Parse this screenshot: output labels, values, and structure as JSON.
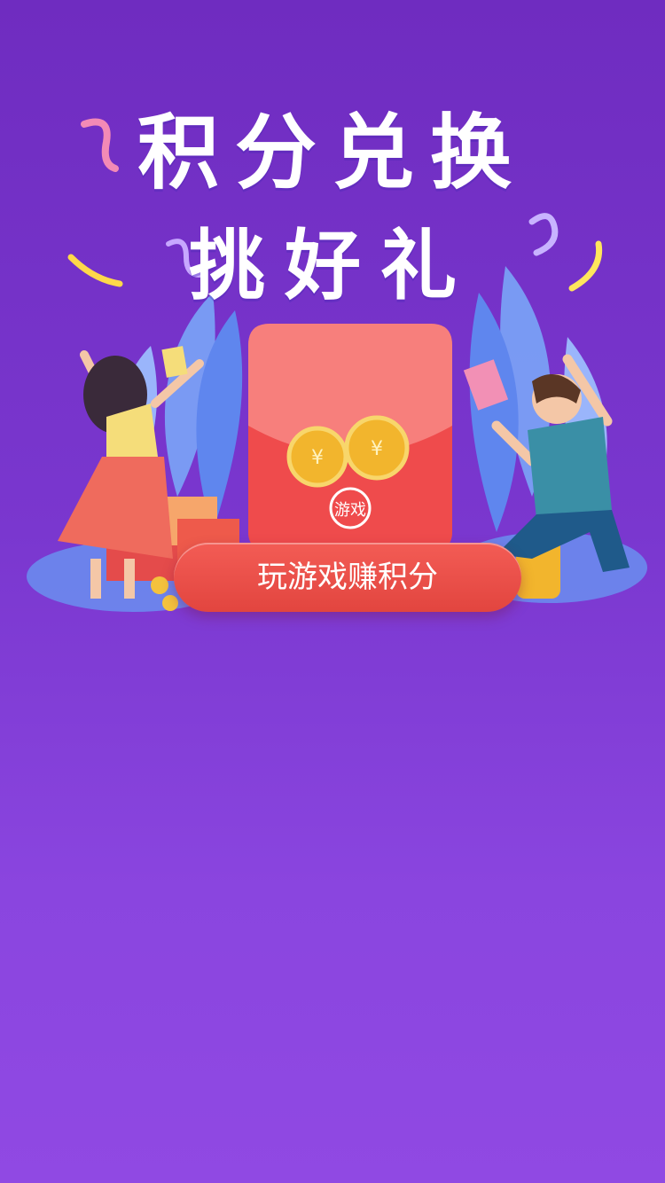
{
  "banner": {
    "title_line1": "积分兑换",
    "title_line2": "挑好礼",
    "envelope_logo_text": "游戏"
  },
  "cta": {
    "label": "玩游戏赚积分"
  },
  "colors": {
    "background_top": "#6f2cc0",
    "background_bottom": "#9049e3",
    "cta_red": "#e2453f",
    "envelope_red": "#ef4b4c"
  }
}
